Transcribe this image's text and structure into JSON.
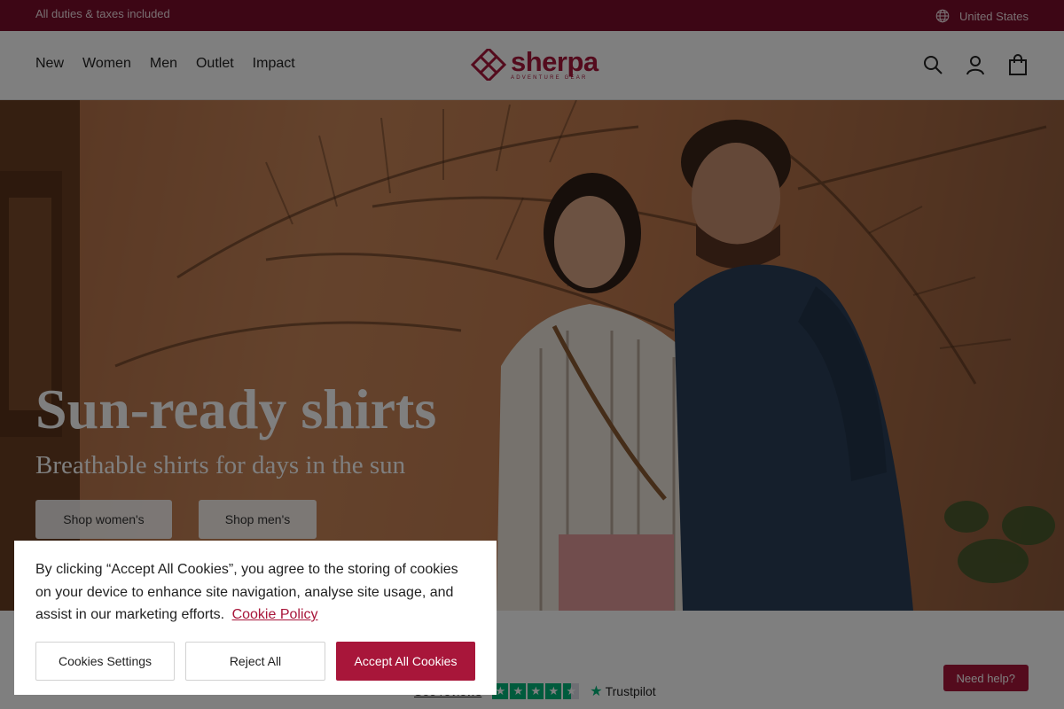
{
  "topbar": {
    "duties_text": "All duties & taxes included",
    "region_icon": "globe-icon",
    "region_label": "United States"
  },
  "header": {
    "nav": [
      "New",
      "Women",
      "Men",
      "Outlet",
      "Impact"
    ],
    "logo_word": "sherpa",
    "logo_tagline": "ADVENTURE GEAR",
    "icons": [
      "search-icon",
      "account-icon",
      "bag-icon"
    ]
  },
  "hero": {
    "title": "Sun-ready shirts",
    "subtitle": "Breathable shirts for days in the sun",
    "button_women": "Shop women's",
    "button_men": "Shop men's"
  },
  "cookie_banner": {
    "message": "By clicking “Accept All Cookies”, you agree to the storing of cookies on your device to enhance site navigation, analyse site usage, and assist in our marketing efforts.",
    "policy_link": "Cookie Policy",
    "settings_button": "Cookies Settings",
    "reject_button": "Reject All",
    "accept_button": "Accept All Cookies"
  },
  "footer_strip": {
    "reviews_link": "See reviews",
    "trustpilot_brand": "Trustpilot",
    "help_button": "Need help?"
  },
  "colors": {
    "brand": "#a8163a",
    "topbar": "#7a0c2a",
    "trustpilot_green": "#00b67a"
  }
}
